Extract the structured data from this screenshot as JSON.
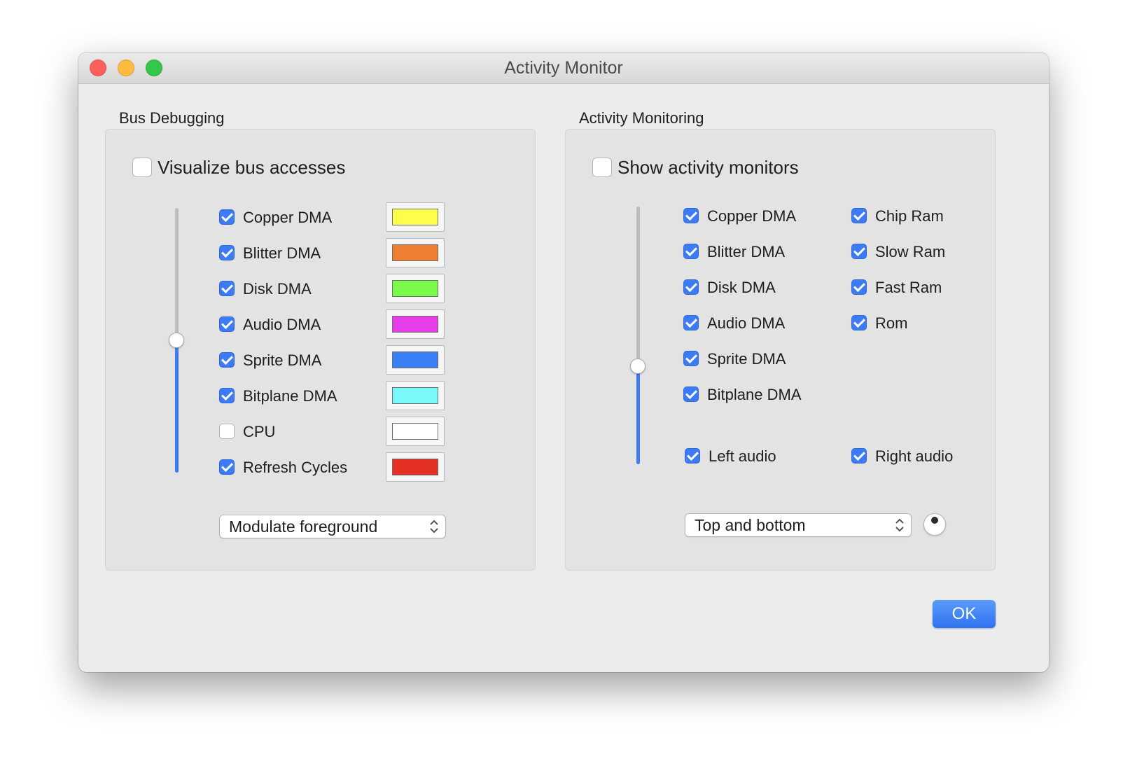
{
  "window": {
    "title": "Activity Monitor"
  },
  "bus_debugging": {
    "group_title": "Bus Debugging",
    "visualize_checkbox": {
      "label": "Visualize bus accesses",
      "checked": false
    },
    "opacity_slider_value": 0.5,
    "items": [
      {
        "label": "Copper DMA",
        "checked": true,
        "color": "#fdfd4a"
      },
      {
        "label": "Blitter DMA",
        "checked": true,
        "color": "#ee7f31"
      },
      {
        "label": "Disk DMA",
        "checked": true,
        "color": "#7afa4b"
      },
      {
        "label": "Audio DMA",
        "checked": true,
        "color": "#e73de8"
      },
      {
        "label": "Sprite DMA",
        "checked": true,
        "color": "#3a7ff5"
      },
      {
        "label": "Bitplane DMA",
        "checked": true,
        "color": "#79f9fa"
      },
      {
        "label": "CPU",
        "checked": false,
        "color": "#ffffff"
      },
      {
        "label": "Refresh Cycles",
        "checked": true,
        "color": "#e53025"
      }
    ],
    "display_mode": {
      "selected": "Modulate foreground"
    }
  },
  "activity_monitoring": {
    "group_title": "Activity Monitoring",
    "show_checkbox": {
      "label": "Show activity monitors",
      "checked": false
    },
    "opacity_slider_value": 0.38,
    "dma_items": [
      {
        "label": "Copper DMA",
        "checked": true
      },
      {
        "label": "Blitter DMA",
        "checked": true
      },
      {
        "label": "Disk DMA",
        "checked": true
      },
      {
        "label": "Audio DMA",
        "checked": true
      },
      {
        "label": "Sprite DMA",
        "checked": true
      },
      {
        "label": "Bitplane DMA",
        "checked": true
      }
    ],
    "memory_items": [
      {
        "label": "Chip Ram",
        "checked": true
      },
      {
        "label": "Slow Ram",
        "checked": true
      },
      {
        "label": "Fast Ram",
        "checked": true
      },
      {
        "label": "Rom",
        "checked": true
      }
    ],
    "audio_items": [
      {
        "label": "Left audio",
        "checked": true
      },
      {
        "label": "Right audio",
        "checked": true
      }
    ],
    "layout_mode": {
      "selected": "Top and bottom"
    }
  },
  "ok_button": {
    "label": "OK"
  },
  "colors": {
    "accent": "#3c7bf5",
    "window_bg": "#ececec",
    "group_bg": "#e3e3e3"
  }
}
